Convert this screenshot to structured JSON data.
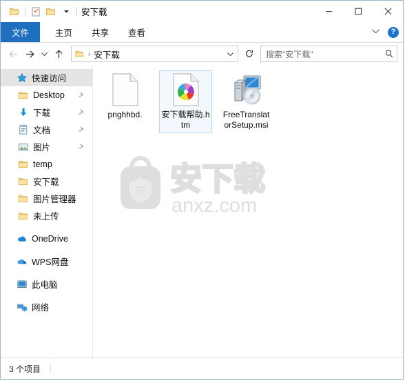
{
  "window": {
    "title": "安下载",
    "quick_access_toolbar": [
      {
        "name": "folder-icon",
        "label": ""
      },
      {
        "name": "properties-icon",
        "label": ""
      },
      {
        "name": "new-folder-icon",
        "label": ""
      },
      {
        "name": "customize-chevron-icon",
        "label": ""
      }
    ],
    "controls": {
      "minimize": "—",
      "maximize": "□",
      "close": "✕"
    }
  },
  "ribbon": {
    "tabs": [
      {
        "label": "文件",
        "active": true
      },
      {
        "label": "主页",
        "active": false
      },
      {
        "label": "共享",
        "active": false
      },
      {
        "label": "查看",
        "active": false
      }
    ],
    "collapse_chevron": "⌄",
    "help_label": "?"
  },
  "address": {
    "back_arrow": "←",
    "forward_arrow": "→",
    "history_chevron": "⌄",
    "up_arrow": "↑",
    "crumb_separator": "›",
    "path": "安下载",
    "path_dropdown": "⌄",
    "refresh": "↻"
  },
  "search": {
    "placeholder": "搜索\"安下载\""
  },
  "sidebar": {
    "items": [
      {
        "label": "快速访问",
        "icon": "star-icon",
        "selected": true,
        "pinned": false,
        "indent": "root"
      },
      {
        "label": "Desktop",
        "icon": "folder-icon",
        "selected": false,
        "pinned": true,
        "indent": "child"
      },
      {
        "label": "下载",
        "icon": "downloads-icon",
        "selected": false,
        "pinned": true,
        "indent": "child"
      },
      {
        "label": "文档",
        "icon": "documents-icon",
        "selected": false,
        "pinned": true,
        "indent": "child"
      },
      {
        "label": "图片",
        "icon": "pictures-icon",
        "selected": false,
        "pinned": true,
        "indent": "child"
      },
      {
        "label": "temp",
        "icon": "folder-icon",
        "selected": false,
        "pinned": false,
        "indent": "child"
      },
      {
        "label": "安下载",
        "icon": "folder-icon",
        "selected": false,
        "pinned": false,
        "indent": "child"
      },
      {
        "label": "图片管理器",
        "icon": "folder-icon",
        "selected": false,
        "pinned": false,
        "indent": "child"
      },
      {
        "label": "未上传",
        "icon": "folder-icon",
        "selected": false,
        "pinned": false,
        "indent": "child"
      },
      {
        "label": "OneDrive",
        "icon": "onedrive-cloud-icon",
        "selected": false,
        "pinned": false,
        "indent": "root",
        "gap_before": true
      },
      {
        "label": "WPS网盘",
        "icon": "wps-cloud-icon",
        "selected": false,
        "pinned": false,
        "indent": "root",
        "gap_before": true
      },
      {
        "label": "此电脑",
        "icon": "this-pc-icon",
        "selected": false,
        "pinned": false,
        "indent": "root",
        "gap_before": true
      },
      {
        "label": "网络",
        "icon": "network-icon",
        "selected": false,
        "pinned": false,
        "indent": "root",
        "gap_before": true
      }
    ]
  },
  "files": [
    {
      "name": "pnghhbd.",
      "icon": "blank-document-icon",
      "selected": false
    },
    {
      "name": "安下载帮助.htm",
      "icon": "chrome-html-icon",
      "selected": true
    },
    {
      "name": "FreeTranslatorSetup.msi",
      "icon": "msi-installer-icon",
      "selected": false
    }
  ],
  "watermark": {
    "text_cn": "安下载",
    "text_domain": "anxz.com",
    "badge_char": "安"
  },
  "statusbar": {
    "item_count": "3 个项目"
  },
  "colors": {
    "accent_blue": "#1e6fbd",
    "selection_blue": "#f2f8fd",
    "selection_border": "#b8d6ea",
    "folder_yellow": "#fcd77f",
    "window_border": "#9ab6cd",
    "watermark_grey": "#dcdcdc"
  }
}
